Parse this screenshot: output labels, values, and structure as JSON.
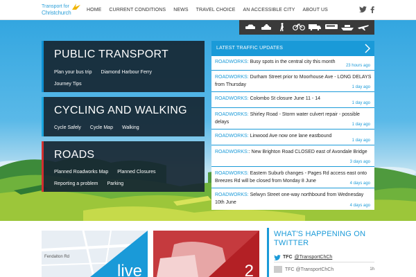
{
  "logo": {
    "line1": "Transport for",
    "line2": "Christchurch"
  },
  "nav": {
    "items": [
      {
        "label": "HOME"
      },
      {
        "label": "CURRENT CONDITIONS"
      },
      {
        "label": "NEWS"
      },
      {
        "label": "TRAVEL CHOICE"
      },
      {
        "label": "AN ACCESSIBLE CITY"
      },
      {
        "label": "ABOUT US"
      }
    ]
  },
  "social": [
    "twitter-icon",
    "facebook-icon"
  ],
  "modes": [
    "car-icon",
    "taxi-icon",
    "pedestrian-icon",
    "bicycle-icon",
    "truck-icon",
    "bus-icon",
    "ferry-icon",
    "plane-icon"
  ],
  "panels": {
    "public_transport": {
      "title": "PUBLIC TRANSPORT",
      "links": [
        "Plan your bus trip",
        "Diamond Harbour Ferry",
        "Journey Tips"
      ]
    },
    "cycling": {
      "title": "CYCLING AND WALKING",
      "links": [
        "Cycle Safely",
        "Cycle Map",
        "Walking"
      ]
    },
    "roads": {
      "title": "ROADS",
      "links": [
        "Planned Roadworks Map",
        "Planned Closures",
        "Reporting a problem",
        "Parking"
      ]
    }
  },
  "traffic": {
    "title": "LATEST TRAFFIC UPDATES",
    "items": [
      {
        "prefix": "ROADWORKS:",
        "text": " Busy spots in the central city this month",
        "ago": "23 hours ago"
      },
      {
        "prefix": "ROADWORKS:",
        "text": " Durham Street prior to Moorhouse Ave - LONG DELAYS from Thursday",
        "ago": "1 day ago"
      },
      {
        "prefix": "ROADWORKS:",
        "text": " Colombo St closure June 11 - 14",
        "ago": "1 day ago"
      },
      {
        "prefix": "ROADWORKS:",
        "text": " Shirley Road - Storm water culvert repair - possible delays",
        "ago": "1 day ago"
      },
      {
        "prefix": "ROADWORKS:",
        "text": " Linwood Ave now one lane eastbound",
        "ago": "1 day ago"
      },
      {
        "prefix": "ROADWORKS:",
        "text": ": New Brighton Road CLOSED east of Avondale Bridge",
        "ago": "3 days ago"
      },
      {
        "prefix": "ROADWORKS:",
        "text": " Eastern Suburb changes - Pages Rd access east onto Breezes Rd will be closed from Monday 8 June",
        "ago": "4 days ago"
      },
      {
        "prefix": "ROADWORKS:",
        "text": " Selwyn Street one-way northbound from Wednesday 10th June",
        "ago": "4 days ago"
      }
    ]
  },
  "tiles": {
    "map_street": "Fendalton Rd",
    "live_label": "live",
    "number_label": "2"
  },
  "twitter": {
    "heading_line1": "WHAT'S HAPPENING ON",
    "heading_line2": "TWITTER",
    "handle_name": "TFC",
    "handle": "@TransportChCh",
    "tweet_author": "TFC @TransportChCh",
    "tweet_age": "1h"
  },
  "colors": {
    "accent": "#1a9ad8",
    "road_red": "#d32f2f",
    "panel": "#162632"
  }
}
